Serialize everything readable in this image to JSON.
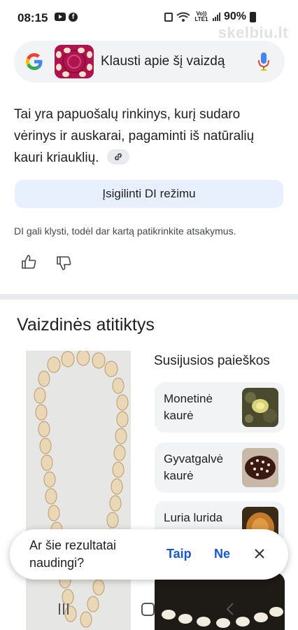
{
  "status_bar": {
    "time": "08:15",
    "battery": "90%",
    "network": "Vo)) LTE1"
  },
  "watermark": "skelbiu.lt",
  "search": {
    "placeholder": "Klausti apie šį vaizdą",
    "icons": [
      "google-logo",
      "image-thumbnail",
      "mic-icon"
    ]
  },
  "ai_answer": {
    "text": "Tai yra papuošalų rinkinys, kurį sudaro vėrinys ir auskarai, pagaminti iš natūralių kauri kriauklių.",
    "deep_mode_button": "Įsigilinti DI režimu",
    "disclaimer": "DI gali klysti, todėl dar kartą patikrinkite atsakymus."
  },
  "visual_matches": {
    "title": "Vaizdinės atitiktys",
    "related_title": "Susijusios paieškos",
    "related": [
      {
        "label": "Monetinė kaurė"
      },
      {
        "label": "Gyvatgalvė kaurė"
      },
      {
        "label": "Luria lurida"
      }
    ]
  },
  "feedback": {
    "question": "Ar šie rezultatai naudingi?",
    "yes": "Taip",
    "no": "Ne"
  },
  "colors": {
    "accent": "#1a57c9",
    "chip_bg": "#e8f0fe",
    "card_bg": "#f1f3f4"
  }
}
